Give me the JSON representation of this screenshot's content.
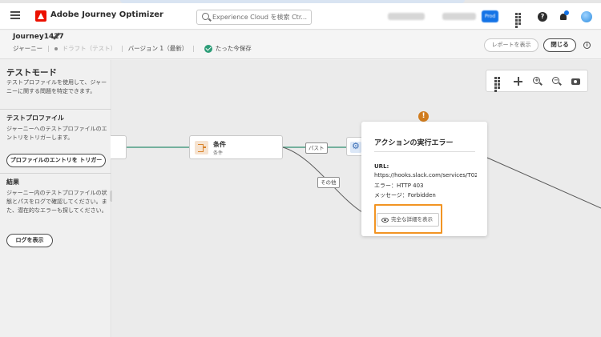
{
  "browser": {},
  "header": {
    "app_name": "Adobe Journey Optimizer",
    "search_placeholder": "Experience Cloud を検索 Ctr...",
    "help_icon": "help-icon",
    "prod_badge": "Prod"
  },
  "journey": {
    "name": "Journey1427",
    "type": "ジャーニー",
    "status": "ドラフト（テスト）",
    "version": "バージョン 1（最新）",
    "saved": "たった今保存",
    "report_button": "レポートを表示",
    "close_button": "閉じる",
    "info_icon": "i"
  },
  "sidebar": {
    "title": "テストモード",
    "intro": "テストプロファイルを使用して、ジャーニーに関する問題を特定できます。",
    "test_profile_heading": "テストプロファイル",
    "test_profile_text": "ジャーニーへのテストプロファイルのエントリをトリガーします。",
    "trigger_button": "プロファイルのエントリを トリガー",
    "results_heading": "結果",
    "results_text": "ジャーニー内のテストプロファイルの状態とパスをログで確認してください。また、潜在的なエラーも探してください。",
    "log_button": "ログを表示"
  },
  "canvas": {
    "condition_node": {
      "title": "条件",
      "subtitle": "条件"
    },
    "edge_labels": {
      "path": "パスト",
      "other": "その他"
    },
    "warning_icon": "!",
    "error_popover": {
      "title": "アクションの実行エラー",
      "url_label": "URL:",
      "url_value": "https://hooks.slack.com/services/T02",
      "error_line": "エラー：HTTP 403",
      "message_line": "メッセージ：Forbidden",
      "details_button": "完全な詳細を表示"
    }
  },
  "colors": {
    "accent": "#1473e6",
    "success": "#2d9d78",
    "warning": "#d07c1f",
    "highlight": "#f29423",
    "edge": "#4d9d83"
  }
}
